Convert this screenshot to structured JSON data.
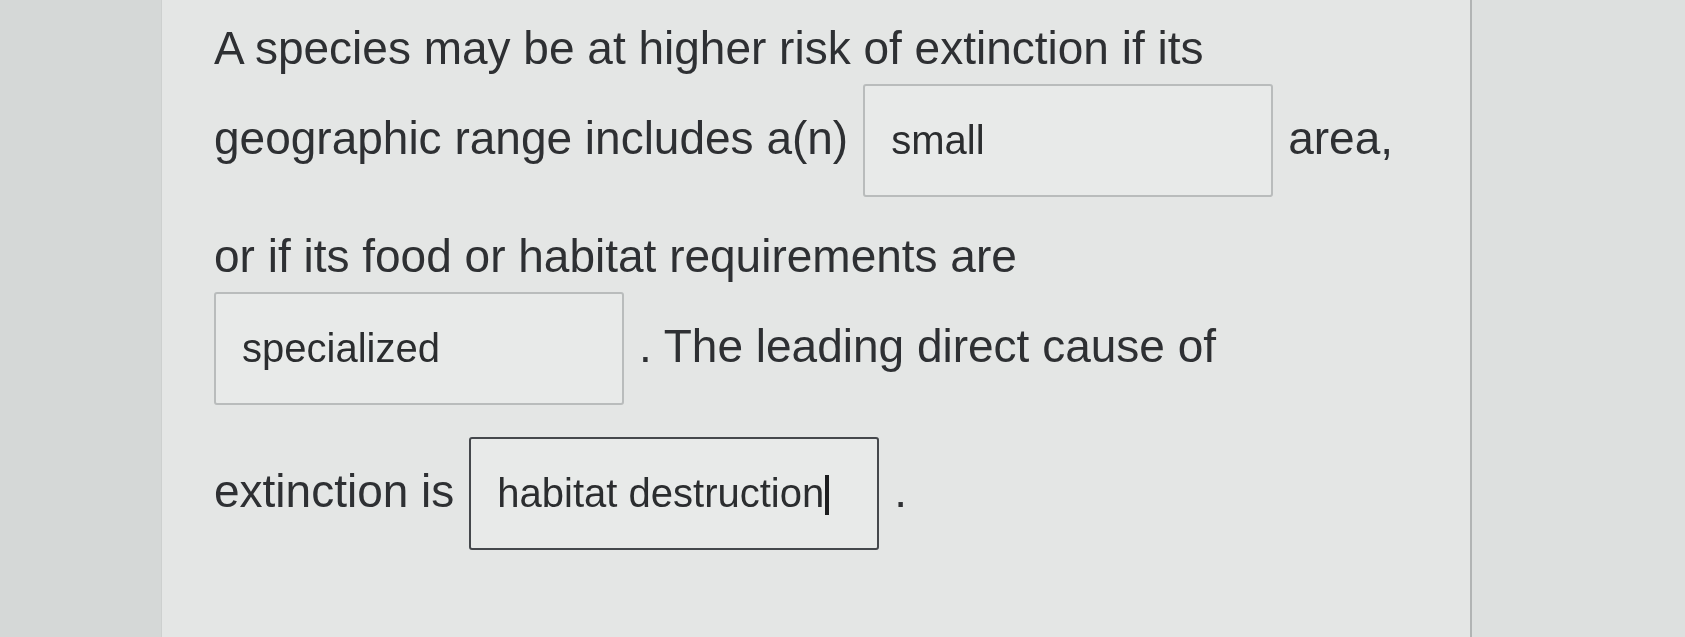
{
  "question": {
    "lines": [
      {
        "parts": [
          {
            "kind": "text",
            "text": "A species may be at higher risk of extinction if its"
          }
        ]
      },
      {
        "parts": [
          {
            "kind": "text",
            "text": "geographic range includes a(n)"
          },
          {
            "kind": "blank",
            "value": "small",
            "focused": false
          },
          {
            "kind": "text",
            "text": "area,"
          }
        ]
      },
      {
        "parts": [
          {
            "kind": "text",
            "text": "or if its food or habitat requirements are"
          }
        ]
      },
      {
        "parts": [
          {
            "kind": "blank",
            "value": "specialized",
            "focused": false
          },
          {
            "kind": "text",
            "text": ". The leading direct cause of"
          }
        ]
      },
      {
        "parts": [
          {
            "kind": "text",
            "text": "extinction is"
          },
          {
            "kind": "blank",
            "value": "habitat destruction",
            "focused": true
          },
          {
            "kind": "text",
            "text": "."
          }
        ]
      }
    ]
  }
}
